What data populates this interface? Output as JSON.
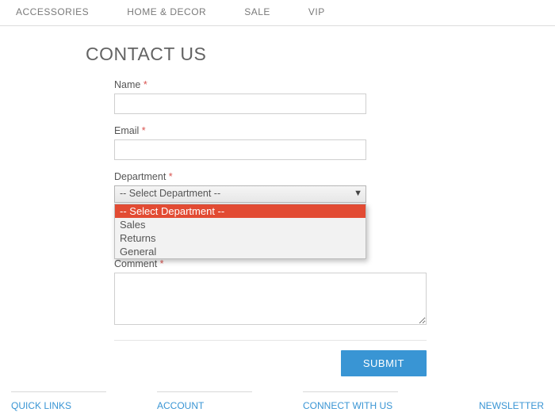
{
  "nav": {
    "items": [
      "ACCESSORIES",
      "HOME & DECOR",
      "SALE",
      "VIP"
    ]
  },
  "page": {
    "title": "CONTACT US"
  },
  "form": {
    "name": {
      "label": "Name",
      "value": ""
    },
    "email": {
      "label": "Email",
      "value": ""
    },
    "department": {
      "label": "Department",
      "selected": "-- Select Department --",
      "options": [
        "-- Select Department --",
        "Sales",
        "Returns",
        "General"
      ]
    },
    "comment": {
      "label": "Comment",
      "value": ""
    },
    "submit_label": "SUBMIT",
    "required_mark": "*"
  },
  "footer": {
    "cols": [
      "QUICK LINKS",
      "ACCOUNT",
      "CONNECT WITH US"
    ],
    "newsletter": "NEWSLETTER"
  },
  "colors": {
    "accent": "#3995d4",
    "danger": "#e24b33"
  }
}
